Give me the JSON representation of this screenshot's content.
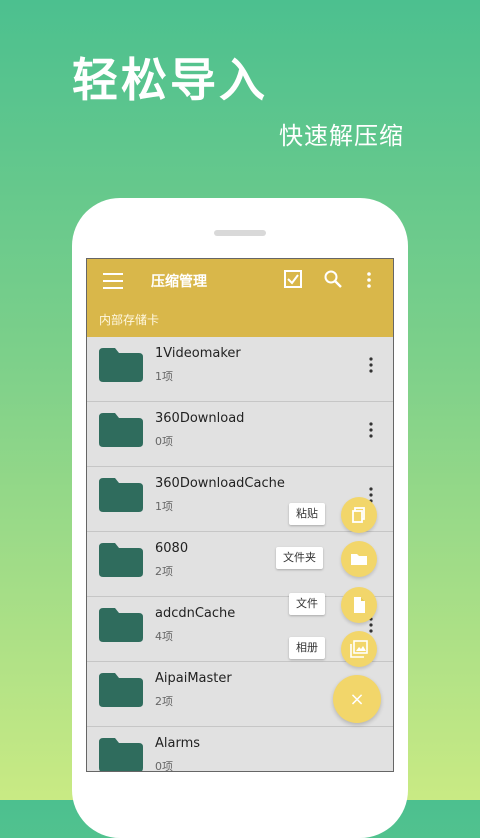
{
  "promo": {
    "title": "轻松导入",
    "subtitle": "快速解压缩"
  },
  "app": {
    "title": "压缩管理",
    "storage": "内部存储卡"
  },
  "files": [
    {
      "name": "1Videomaker",
      "count": "1项"
    },
    {
      "name": "360Download",
      "count": "0项"
    },
    {
      "name": "360DownloadCache",
      "count": "1项"
    },
    {
      "name": "6080",
      "count": "2项"
    },
    {
      "name": "adcdnCache",
      "count": "4项"
    },
    {
      "name": "AipaiMaster",
      "count": "2项"
    },
    {
      "name": "Alarms",
      "count": "0项"
    }
  ],
  "fab_menu": {
    "paste": "粘贴",
    "folder": "文件夹",
    "file": "文件",
    "album": "相册",
    "close": "×"
  },
  "colors": {
    "accent": "#d9b74a",
    "folder": "#2f6c5d",
    "fab": "#f2d66a"
  },
  "icons": [
    "menu-icon",
    "checkbox-icon",
    "search-icon",
    "more-vert-icon",
    "folder-icon",
    "paste-icon",
    "folder-icon",
    "file-icon",
    "image-icon",
    "close-icon"
  ]
}
